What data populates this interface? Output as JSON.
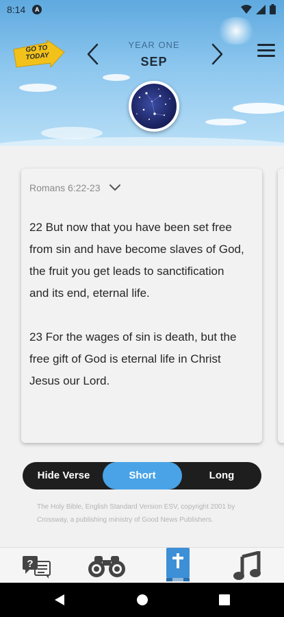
{
  "status_bar": {
    "time": "8:14",
    "app_indicator": "A",
    "icons": [
      "wifi-icon",
      "signal-icon",
      "battery-icon"
    ]
  },
  "header": {
    "go_to_today_line1": "GO TO",
    "go_to_today_line2": "TODAY",
    "year_label": "YEAR ONE",
    "month_label": "SEP",
    "prev_icon": "chevron-left-icon",
    "next_icon": "chevron-right-icon",
    "menu_icon": "hamburger-menu-icon",
    "orb_image": "starry-night-constellation"
  },
  "verse": {
    "reference": "Romans 6:22-23",
    "text": "22 But now that you have been set free from sin and have become slaves of God, the fruit you get leads to sanctification\nand its end, eternal life.\n\n23 For the wages of sin is death, but the free gift of God is eternal life in Christ\nJesus our Lord."
  },
  "toggle": {
    "options": [
      "Hide Verse",
      "Short",
      "Long"
    ],
    "selected": "Short",
    "accent": "#4aa3e6"
  },
  "copyright": "The Holy Bible, English Standard Version ESV, copyright 2001 by Crossway, a publishing ministry of Good News Publishers.",
  "bottom_nav": {
    "items": [
      "question-chat-icon",
      "binoculars-icon",
      "bible-icon",
      "music-note-icon"
    ],
    "active": "bible-icon",
    "active_color": "#3d8fd6"
  },
  "system_nav": [
    "back-icon",
    "home-icon",
    "recents-icon"
  ]
}
